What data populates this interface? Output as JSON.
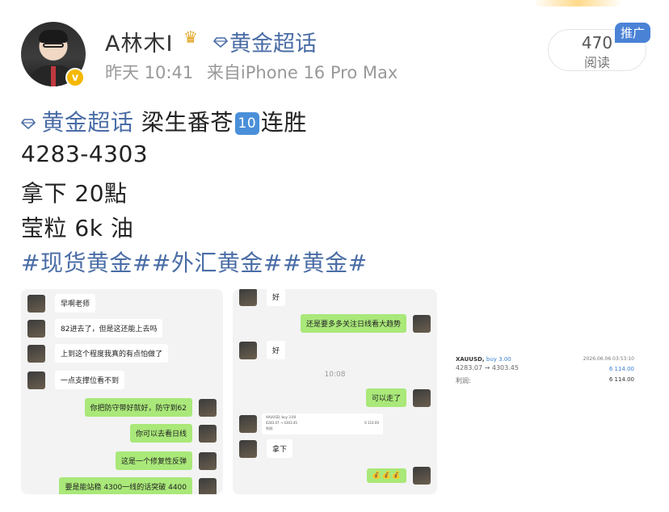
{
  "header": {
    "username": "A林木I",
    "verified_glyph": "v",
    "topic": "黄金超话",
    "time": "昨天 10:41",
    "source": "来自iPhone 16 Pro Max",
    "read_count": "470",
    "read_label": "阅读",
    "ad_tag": "推广"
  },
  "post": {
    "topic_link": "黄金超话",
    "line1_text": "梁生番苍",
    "badge": "10",
    "line1_suffix": "连胜",
    "line2": "4283-4303",
    "line3": "拿下 20點",
    "line4": "莹粒 6k 油",
    "hashtags": "#现货黄金##外汇黄金##黄金#"
  },
  "image1": {
    "messages": [
      {
        "side": "in",
        "text": "早啊老师"
      },
      {
        "side": "in",
        "text": "82进去了，但是这还能上去吗"
      },
      {
        "side": "in",
        "text": "上到这个程度我真的有点怕做了"
      },
      {
        "side": "in",
        "text": "一点支撑位看不到"
      },
      {
        "side": "out",
        "text": "你把防守带好就好，防守到62"
      },
      {
        "side": "out",
        "text": "你可以去看日线"
      },
      {
        "side": "out",
        "text": "这是一个修复性反弹"
      },
      {
        "side": "out",
        "text": "要是能站稳 4300一线的话突破 4400"
      }
    ]
  },
  "image2": {
    "msg_hao1": "好",
    "msg_trend": "还是要多多关注日线看大趋势",
    "msg_hao2": "好",
    "time": "10:08",
    "msg_ok": "可以走了",
    "mini_symbol": "XAUUSD, buy 3.00",
    "mini_price": "4283.07 → 4303.45",
    "mini_profit": "6 114.00",
    "mini_label": "利润:",
    "msg_take": "拿下",
    "emoji": "💰💰💰"
  },
  "image3": {
    "symbol": "XAUUSD,",
    "side": "buy 3.00",
    "date": "2026.06.06 03:53:10",
    "price": "4283.07 → 4303.45",
    "profit_line": "6 114.00",
    "profit_label": "利润:",
    "profit_total": "6 114.00"
  }
}
